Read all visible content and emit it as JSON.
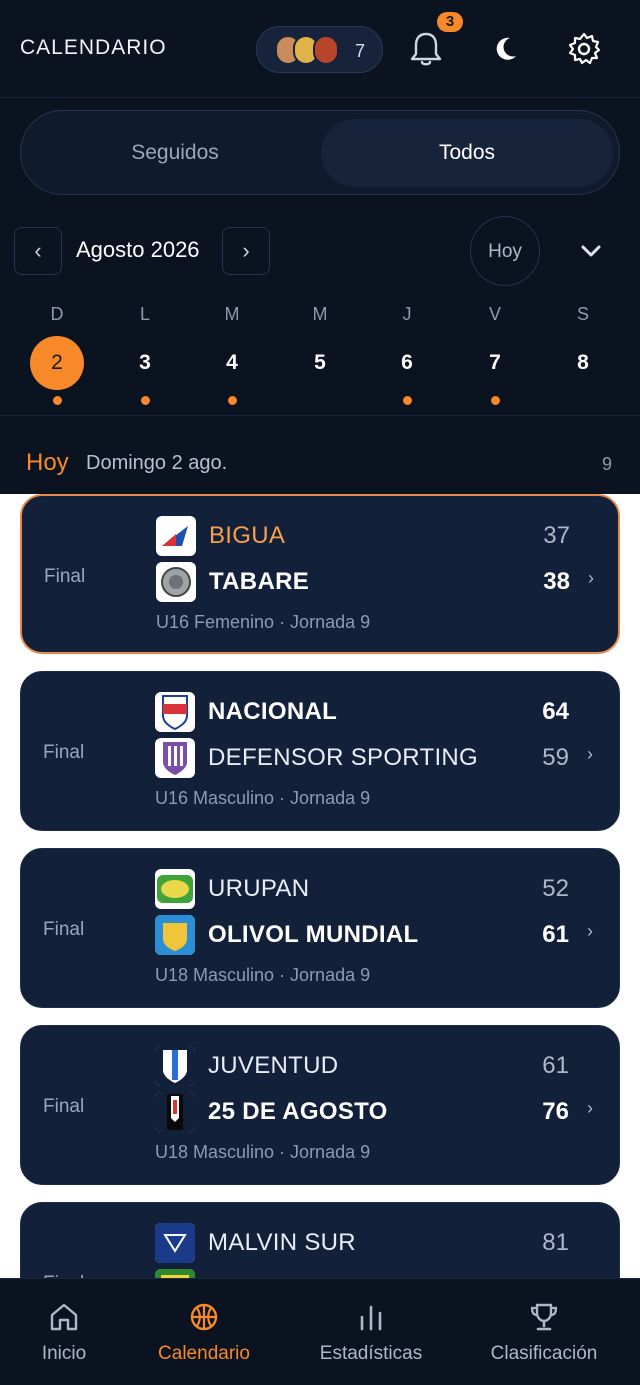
{
  "header": {
    "title": "CALENDARIO",
    "followers_count": "7",
    "notifications_badge": "3"
  },
  "segment": {
    "left": "Seguidos",
    "right": "Todos",
    "selected": "Todos"
  },
  "calendar": {
    "month": "Agosto 2026",
    "prev_label": "‹",
    "next_label": "›",
    "today_label": "Hoy",
    "days": [
      {
        "letter": "D",
        "num": "2",
        "selected": true,
        "has_games": true
      },
      {
        "letter": "L",
        "num": "3",
        "selected": false,
        "has_games": true
      },
      {
        "letter": "M",
        "num": "4",
        "selected": false,
        "has_games": true
      },
      {
        "letter": "M",
        "num": "5",
        "selected": false,
        "has_games": false
      },
      {
        "letter": "J",
        "num": "6",
        "selected": false,
        "has_games": true
      },
      {
        "letter": "V",
        "num": "7",
        "selected": false,
        "has_games": true
      },
      {
        "letter": "S",
        "num": "8",
        "selected": false,
        "has_games": false
      }
    ]
  },
  "day_header": {
    "tag": "Hoy",
    "date": "Domingo 2 ago.",
    "count": "9"
  },
  "matches": [
    {
      "status": "Final",
      "home": {
        "name": "BIGUA",
        "score": "37"
      },
      "away": {
        "name": "TABARE",
        "score": "38"
      },
      "meta": "U16 Femenino · Jornada 9"
    },
    {
      "status": "Final",
      "home": {
        "name": "NACIONAL",
        "score": "64"
      },
      "away": {
        "name": "DEFENSOR SPORTING",
        "score": "59"
      },
      "meta": "U16 Masculino · Jornada 9"
    },
    {
      "status": "Final",
      "home": {
        "name": "URUPAN",
        "score": "52"
      },
      "away": {
        "name": "OLIVOL MUNDIAL",
        "score": "61"
      },
      "meta": "U18 Masculino · Jornada 9"
    },
    {
      "status": "Final",
      "home": {
        "name": "JUVENTUD",
        "score": "61"
      },
      "away": {
        "name": "25 DE AGOSTO",
        "score": "76"
      },
      "meta": "U18 Masculino · Jornada 9"
    },
    {
      "status": "Final",
      "home": {
        "name": "MALVIN SUR",
        "score": "81"
      }
    }
  ],
  "bottom_nav": [
    {
      "label": "Inicio",
      "icon": "home-icon"
    },
    {
      "label": "Calendario",
      "icon": "basketball-icon",
      "active": true
    },
    {
      "label": "Estadísticas",
      "icon": "bar-chart-icon"
    },
    {
      "label": "Clasificación",
      "icon": "trophy-icon"
    }
  ],
  "colors": {
    "accent": "#f7892b",
    "background": "#0b1220",
    "card": "#13203a"
  }
}
